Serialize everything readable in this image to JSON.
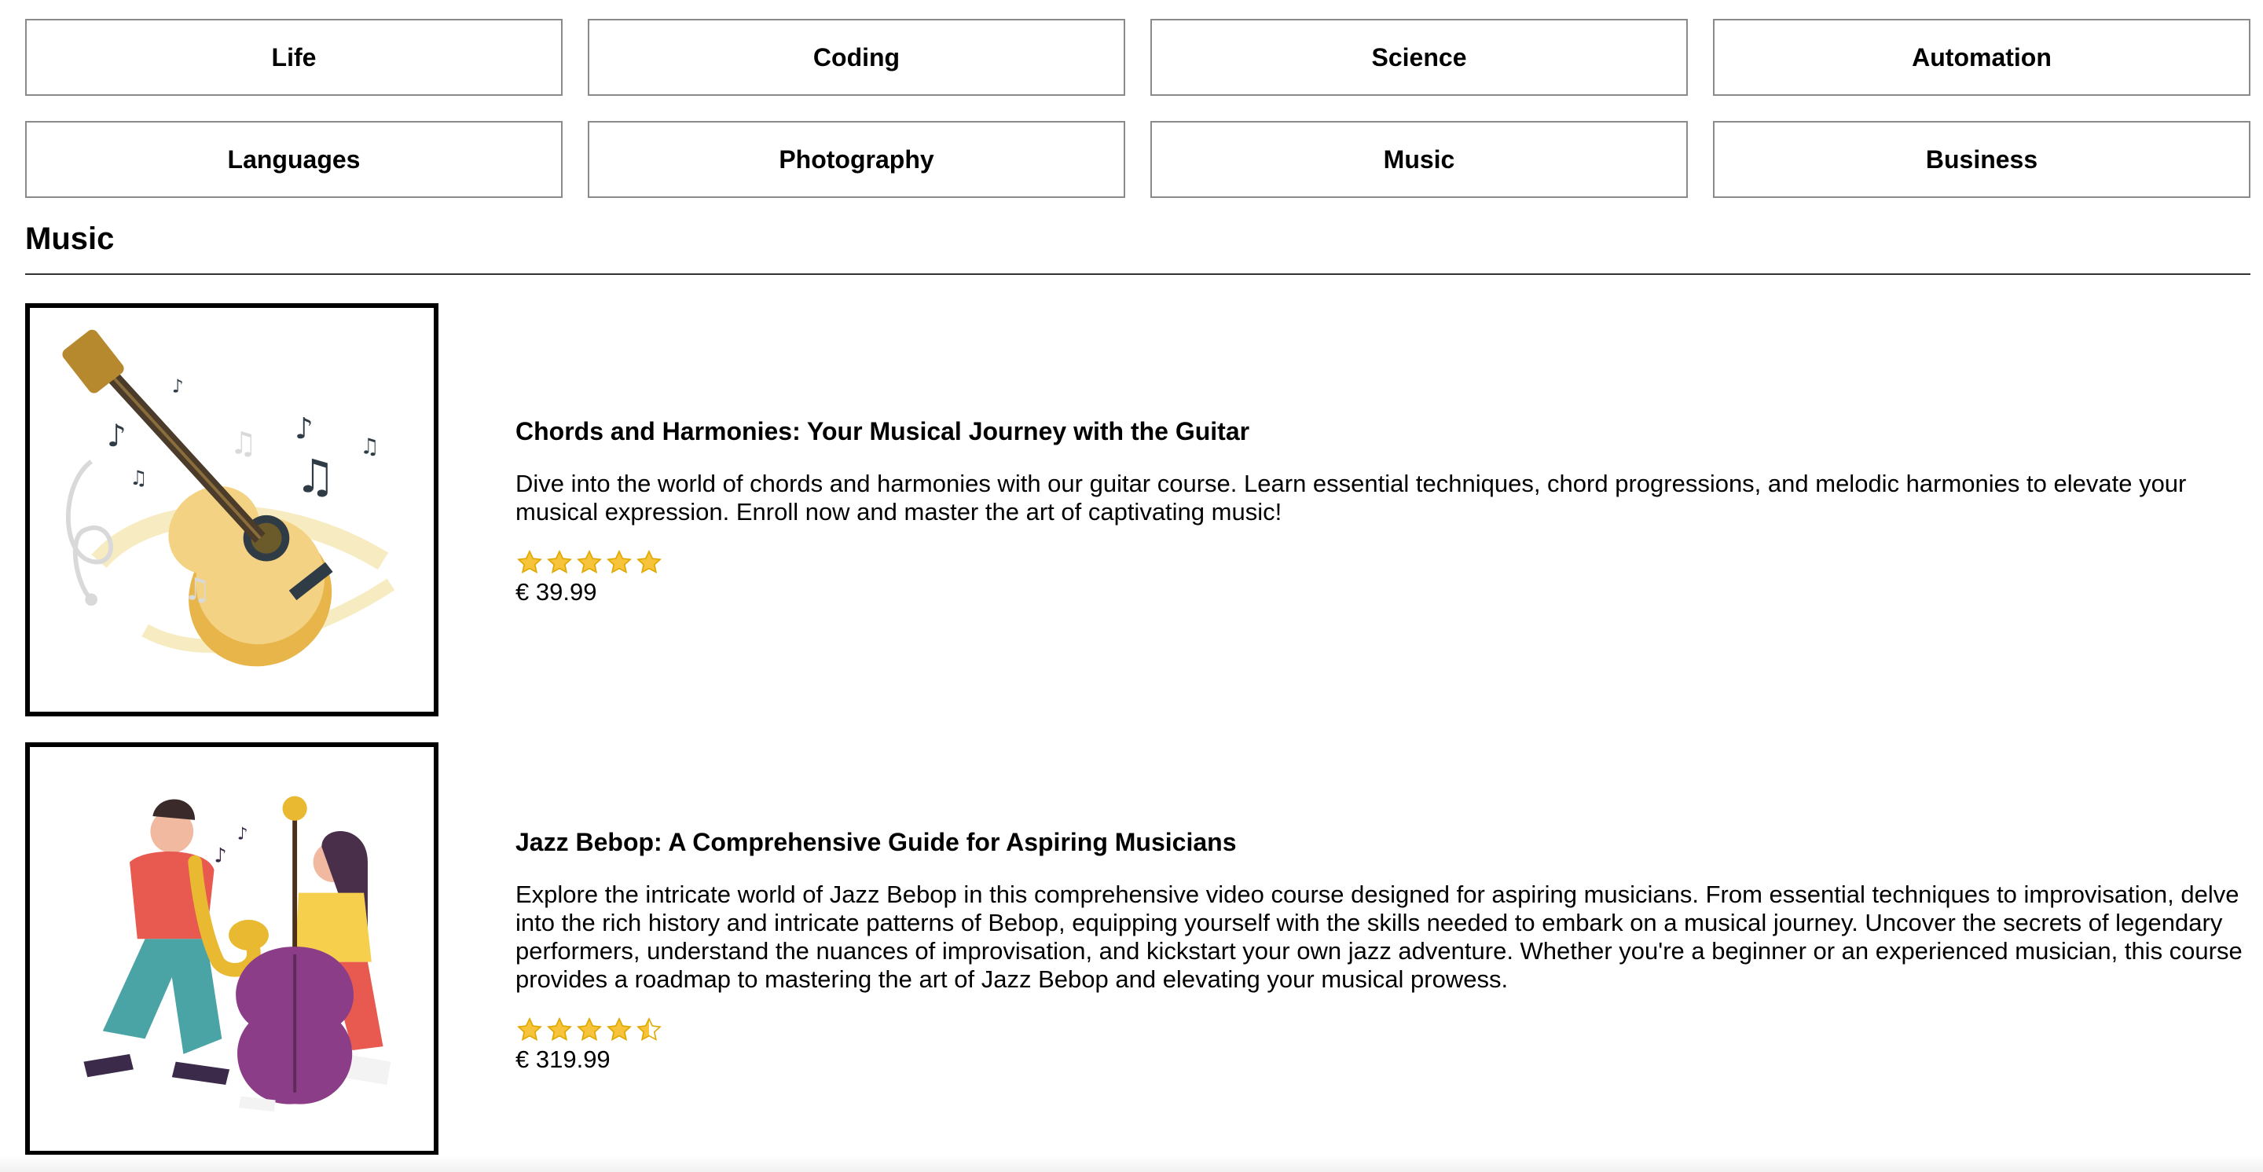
{
  "categories": [
    "Life",
    "Coding",
    "Science",
    "Automation",
    "Languages",
    "Photography",
    "Music",
    "Business"
  ],
  "section": {
    "title": "Music"
  },
  "courses": [
    {
      "title": "Chords and Harmonies: Your Musical Journey with the Guitar",
      "description": "Dive into the world of chords and harmonies with our guitar course. Learn essential techniques, chord progressions, and melodic harmonies to elevate your musical expression. Enroll now and master the art of captivating music!",
      "rating": 5,
      "price": "€ 39.99",
      "image_icon": "guitar-illustration"
    },
    {
      "title": "Jazz Bebop: A Comprehensive Guide for Aspiring Musicians",
      "description": "Explore the intricate world of Jazz Bebop in this comprehensive video course designed for aspiring musicians. From essential techniques to improvisation, delve into the rich history and intricate patterns of Bebop, equipping yourself with the skills needed to embark on a musical journey. Uncover the secrets of legendary performers, understand the nuances of improvisation, and kickstart your own jazz adventure. Whether you're a beginner or an experienced musician, this course provides a roadmap to mastering the art of Jazz Bebop and elevating your musical prowess.",
      "rating": 4.5,
      "price": "€ 319.99",
      "image_icon": "jazz-musicians-illustration"
    }
  ],
  "colors": {
    "star": "#f6c33a",
    "star_outline": "#e0a800",
    "border": "#8a8a8a"
  }
}
